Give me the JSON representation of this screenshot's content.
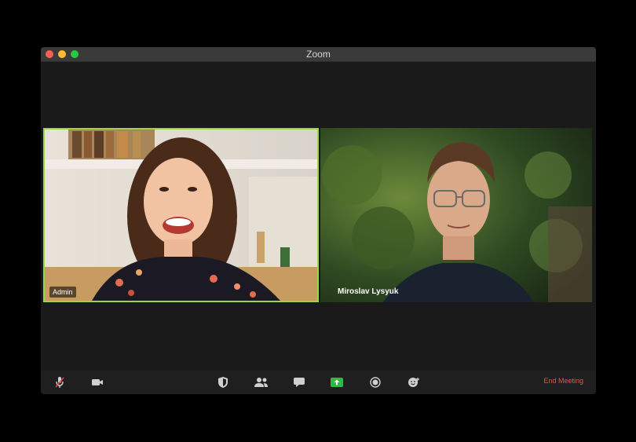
{
  "window": {
    "title": "Zoom"
  },
  "participants": [
    {
      "name": "Admin",
      "active_speaker": true
    },
    {
      "name": "Miroslav Lysyuk",
      "active_speaker": false
    }
  ],
  "toolbar": {
    "icons": [
      "microphone-icon",
      "video-icon",
      "security-icon",
      "participants-icon",
      "chat-icon",
      "share-screen-icon",
      "record-icon",
      "reactions-icon"
    ],
    "end_meeting_label": "End Meeting"
  },
  "colors": {
    "active_speaker_border": "#9bd64a",
    "end_meeting": "#ff4a4a",
    "share_screen": "#2fb847"
  }
}
